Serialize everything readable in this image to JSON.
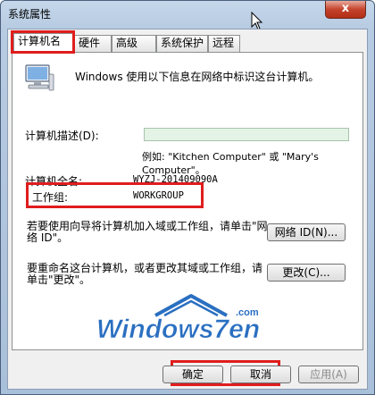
{
  "window": {
    "title": "系统属性",
    "close_label": "x"
  },
  "tabs": [
    "计算机名",
    "硬件",
    "高级",
    "系统保护",
    "远程"
  ],
  "panel": {
    "description": "Windows 使用以下信息在网络中标识这台计算机。",
    "computer_desc_label": "计算机描述(D):",
    "computer_desc_value": "",
    "example_text": "例如: \"Kitchen Computer\" 或 \"Mary's Computer\"。",
    "full_name_label": "计算机全名:",
    "full_name_value": "WYZJ-201409090A",
    "workgroup_label": "工作组:",
    "workgroup_value": "WORKGROUP",
    "network_id_text": "若要使用向导将计算机加入域或工作组，请单击\"网络 ID\"。",
    "network_id_button": "网络 ID(N)...",
    "rename_text": "要重命名这台计算机，或者更改其域或工作组，请单击\"更改\"。",
    "change_button": "更改(C)..."
  },
  "watermark": {
    "text": "Windows7en",
    "domain": ".com"
  },
  "footer": {
    "ok": "确定",
    "cancel": "取消",
    "apply": "应用(A)"
  },
  "colors": {
    "highlight": "#e01d1d",
    "input_bg": "#e3f3e5",
    "logo_blue": "#2a6fc1"
  }
}
